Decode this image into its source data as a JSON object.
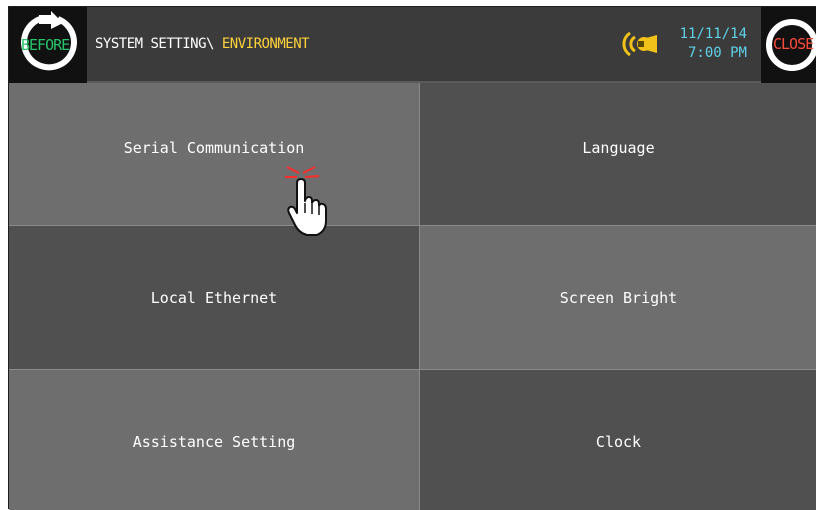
{
  "topbar": {
    "before_label": "BEFORE",
    "close_label": "CLOSE",
    "path_prefix": "SYSTEM SETTING\\ ",
    "path_current": "ENVIRONMENT",
    "date": "11/11/14",
    "time": "7:00 PM"
  },
  "tiles": [
    {
      "label": "Serial Communication"
    },
    {
      "label": "Language"
    },
    {
      "label": "Local Ethernet"
    },
    {
      "label": "Screen Bright"
    },
    {
      "label": "Assistance Setting"
    },
    {
      "label": "Clock"
    }
  ],
  "colors": {
    "before_accent": "#27c36a",
    "close_accent": "#ff4a3a",
    "path_current": "#ffd23a",
    "datetime": "#5fd2e8",
    "speaker": "#f2c21b"
  },
  "icons": [
    "back-arrow-icon",
    "close-circle-icon",
    "speaker-icon",
    "hand-pointer-icon"
  ]
}
